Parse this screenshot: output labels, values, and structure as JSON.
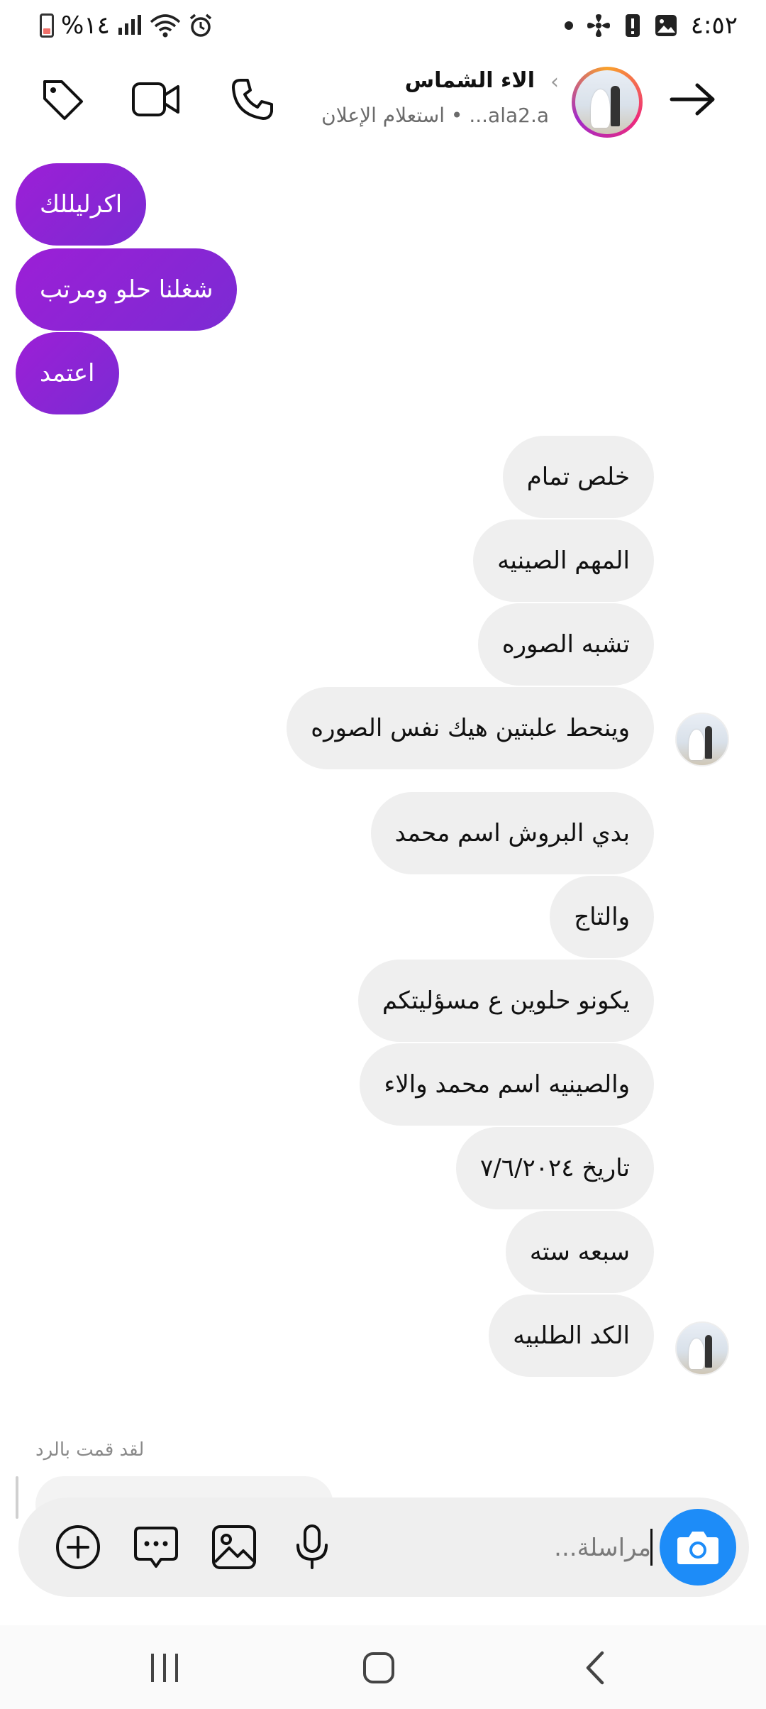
{
  "status_bar": {
    "battery_percent": "%١٤",
    "time": "٤:٥٢"
  },
  "header": {
    "contact_name": "الاء الشماس",
    "subtitle": "ala2.a... • استعلام الإعلان"
  },
  "messages": {
    "sent": [
      "اكرليللك",
      "شغلنا حلو ومرتب",
      "اعتمد"
    ],
    "received": [
      "خلص تمام",
      "المهم الصينيه",
      "تشبه الصوره",
      "وينحط علبتين هيك نفس  الصوره",
      "بدي البروش اسم محمد",
      "والتاج",
      "يكونو حلوين ع مسؤليتكم",
      "والصينيه اسم محمد والاء",
      "تاريخ ٧/٦/٢٠٢٤",
      "سبعه سته",
      "الكد الطلبيه"
    ]
  },
  "replied_label": "لقد قمت بالرد",
  "composer": {
    "placeholder": "مراسلة..."
  },
  "colors": {
    "sent_bubble": "#9c1fd6",
    "received_bubble": "#efefef",
    "camera_button": "#1d8cf8"
  }
}
